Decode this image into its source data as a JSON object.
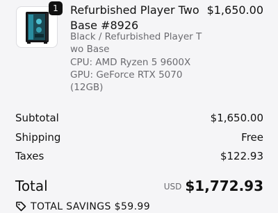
{
  "cart_item": {
    "quantity": "1",
    "name": "Refurbished Player Two Base #8926",
    "price": "$1,650.00",
    "variant": "Black / Refurbished Player Two Base",
    "cpu": "CPU: AMD Ryzen 5 9600X",
    "gpu": "GPU: GeForce RTX 5070 (12GB)",
    "image_icon": "pc-case-thumbnail"
  },
  "summary": {
    "subtotal_label": "Subtotal",
    "subtotal_value": "$1,650.00",
    "shipping_label": "Shipping",
    "shipping_value": "Free",
    "taxes_label": "Taxes",
    "taxes_value": "$122.93"
  },
  "total": {
    "label": "Total",
    "currency": "USD",
    "amount": "$1,772.93"
  },
  "savings": {
    "text": "TOTAL SAVINGS $59.99",
    "icon": "tag-icon"
  }
}
